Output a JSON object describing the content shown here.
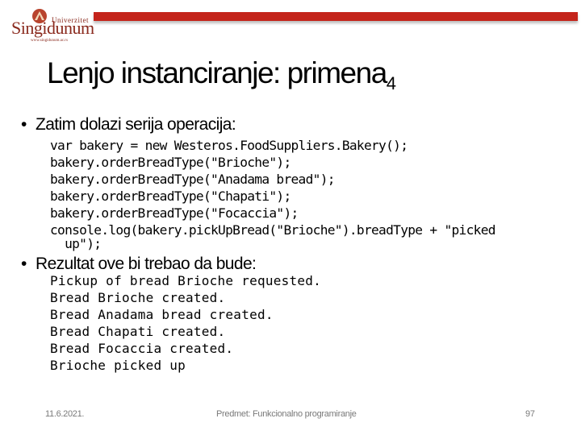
{
  "logo": {
    "top_text": "Univerzitet",
    "main_text": "Singidunum",
    "url_text": "www.singidunum.ac.rs"
  },
  "accent_color": "#c4241b",
  "slide": {
    "title": "Lenjo instanciranje: primena",
    "title_subscript": "4",
    "bullets": [
      {
        "text": "Zatim dolazi serija operacija:",
        "code_lines": [
          "var bakery = new Westeros.FoodSuppliers.Bakery();",
          "bakery.orderBreadType(\"Brioche\");",
          "bakery.orderBreadType(\"Anadama bread\");",
          "bakery.orderBreadType(\"Chapati\");",
          "bakery.orderBreadType(\"Focaccia\");",
          "console.log(bakery.pickUpBread(\"Brioche\").breadType + \"picked",
          "  up\");"
        ]
      },
      {
        "text": "Rezultat ove bi trebao da bude:",
        "code_lines": [
          "Pickup of bread Brioche requested.",
          "Bread Brioche created.",
          "Bread Anadama bread created.",
          "Bread Chapati created.",
          "Bread Focaccia created.",
          "Brioche picked up"
        ]
      }
    ]
  },
  "footer": {
    "date": "11.6.2021.",
    "course": "Predmet: Funkcionalno programiranje",
    "page_number": "97"
  }
}
